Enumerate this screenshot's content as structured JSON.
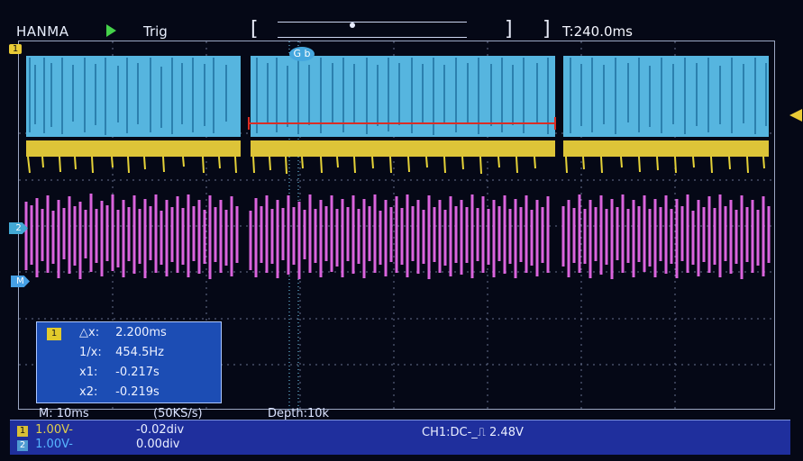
{
  "header": {
    "brand": "HANMA",
    "trigger_label": "Trig",
    "timebase": "T:240.0ms"
  },
  "markers": {
    "ch1": "1",
    "ch2": "2",
    "math": "M",
    "trigger_badge": "G b"
  },
  "measurements": {
    "badge": "1",
    "rows": [
      {
        "label": "△x:",
        "value": "2.200ms"
      },
      {
        "label": "1/x:",
        "value": "454.5Hz"
      },
      {
        "label": "x1:",
        "value": "-0.217s"
      },
      {
        "label": "x2:",
        "value": "-0.219s"
      }
    ]
  },
  "status": {
    "time_div": "M: 10ms",
    "sample_rate": "(50KS/s)",
    "depth": "Depth:10k"
  },
  "channels": [
    {
      "badge": "1",
      "volts": "1.00V-",
      "offset": "-0.02div"
    },
    {
      "badge": "2",
      "volts": "1.00V-",
      "offset": "0.00div"
    }
  ],
  "trigger_info": "CH1:DC-_⎍ 2.48V",
  "colors": {
    "ch1": "#e6c62d",
    "ch2": "#4da8e0",
    "math": "#d55bd3",
    "grid": "#77819f",
    "cursor": "#db2d24"
  }
}
